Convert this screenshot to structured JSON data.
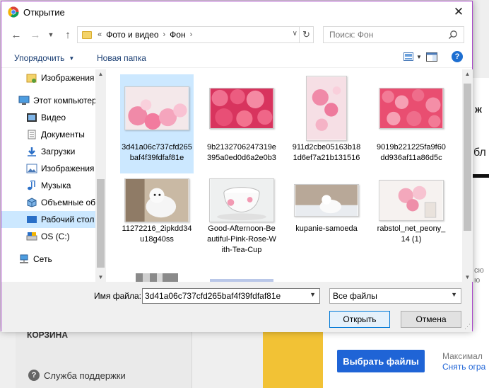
{
  "background": {
    "cart": "КОРЗИНА",
    "support": "Служба поддержки",
    "choose_files": "Выбрать файлы",
    "max_text": "Максимал",
    "change_text": "Снять огра",
    "right_text_1": "ж",
    "right_text_2": "бл",
    "right_text_3": "сю",
    "right_text_4": "ю"
  },
  "dialog": {
    "title": "Открытие",
    "address": {
      "overflow": "«",
      "crumbs": [
        "Фото и видео",
        "Фон"
      ]
    },
    "search_placeholder": "Поиск: Фон",
    "toolbar": {
      "organize": "Упорядочить",
      "new_folder": "Новая папка"
    },
    "nav": [
      {
        "label": "Изображения",
        "icon": "pictures-folder-icon"
      },
      {
        "label": "Этот компьютер",
        "icon": "computer-icon"
      },
      {
        "label": "Видео",
        "icon": "video-folder-icon"
      },
      {
        "label": "Документы",
        "icon": "documents-folder-icon"
      },
      {
        "label": "Загрузки",
        "icon": "downloads-folder-icon"
      },
      {
        "label": "Изображения",
        "icon": "pictures-folder-icon"
      },
      {
        "label": "Музыка",
        "icon": "music-folder-icon"
      },
      {
        "label": "Объемные объекты",
        "icon": "3d-objects-icon"
      },
      {
        "label": "Рабочий стол",
        "icon": "desktop-folder-icon"
      },
      {
        "label": "OS (C:)",
        "icon": "drive-icon"
      },
      {
        "label": "Сеть",
        "icon": "network-icon"
      }
    ],
    "files": [
      {
        "name": "3d41a06c737cfd265baf4f39fdfaf81e",
        "selected": true
      },
      {
        "name": "9b2132706247319e395a0ed0d6a2e0b3",
        "selected": false
      },
      {
        "name": "911d2cbe05163b181d6ef7a21b131516",
        "selected": false
      },
      {
        "name": "9019b221225fa9f60dd936af11a86d5c",
        "selected": false
      },
      {
        "name": "11272216_2ipkdd34u18g40ss",
        "selected": false
      },
      {
        "name": "Good-Afternoon-Beautiful-Pink-Rose-With-Tea-Cup",
        "selected": false
      },
      {
        "name": "kupanie-samoeda",
        "selected": false
      },
      {
        "name": "rabstol_net_peony_14 (1)",
        "selected": false
      }
    ],
    "filename_label": "Имя файла:",
    "filename_value": "3d41a06c737cfd265baf4f39fdfaf81e",
    "filetype": "Все файлы",
    "open_button": "Открыть",
    "cancel_button": "Отмена"
  },
  "colors": {
    "selection": "#cce8ff",
    "accent": "#0078d7",
    "link": "#1a3e73",
    "dialog_border": "#a946c9",
    "bg_button": "#1f64d6",
    "bg_yellow": "#f2c235"
  }
}
